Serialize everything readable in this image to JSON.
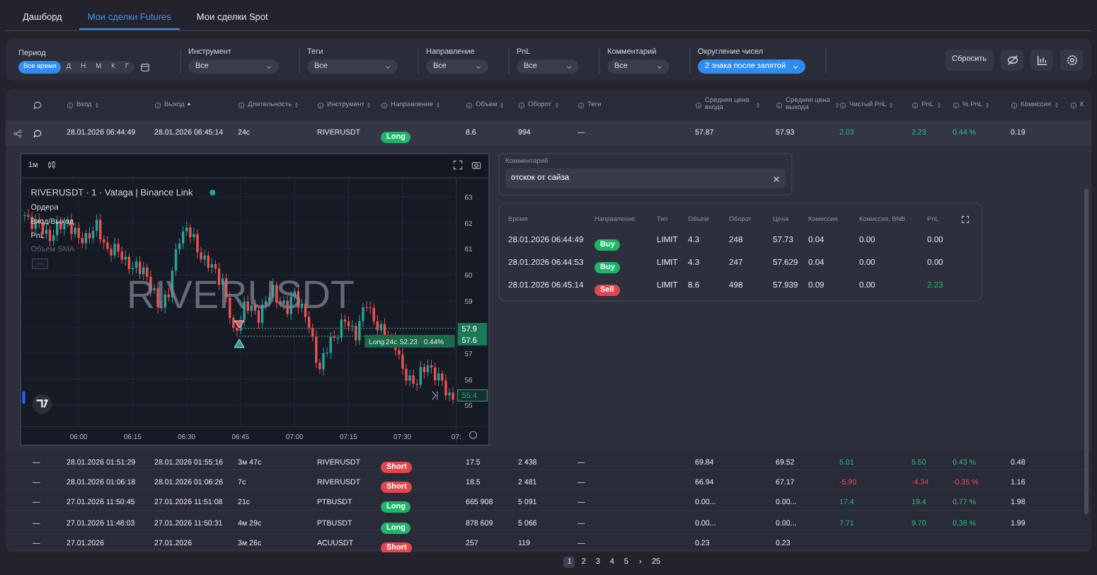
{
  "tabs": [
    {
      "label": "Дашборд",
      "selected": false
    },
    {
      "label": "Мои сделки Futures",
      "selected": true
    },
    {
      "label": "Мои сделки Spot",
      "selected": false
    }
  ],
  "filters": {
    "period": {
      "label": "Период",
      "options": [
        {
          "label": "Все время",
          "selected": true
        },
        {
          "label": "Д",
          "selected": false
        },
        {
          "label": "Н",
          "selected": false
        },
        {
          "label": "М",
          "selected": false
        },
        {
          "label": "К",
          "selected": false
        },
        {
          "label": "Г",
          "selected": false
        }
      ]
    },
    "dropdowns": [
      {
        "label": "Инструмент",
        "value": "Все",
        "active": false
      },
      {
        "label": "Теги",
        "value": "Все",
        "active": false
      },
      {
        "label": "Направление",
        "value": "Все",
        "active": false
      },
      {
        "label": "PnL",
        "value": "Все",
        "active": false
      },
      {
        "label": "Комментарий",
        "value": "Все",
        "active": false
      },
      {
        "label": "Округление чисел",
        "value": "2 знака после запятой",
        "active": true
      }
    ],
    "reset_button": "Сбросить"
  },
  "table": {
    "columns": [
      {
        "label": "Вход",
        "sortable": true,
        "sorted": false
      },
      {
        "label": "Выход",
        "sortable": true,
        "sorted": true
      },
      {
        "label": "Длительность",
        "sortable": true,
        "sorted": false
      },
      {
        "label": "Инструмент",
        "sortable": true,
        "sorted": false
      },
      {
        "label": "Направление",
        "sortable": true,
        "sorted": false
      },
      {
        "label": "Объем",
        "sortable": true,
        "sorted": false
      },
      {
        "label": "Оборот",
        "sortable": true,
        "sorted": false
      },
      {
        "label": "Теги",
        "sortable": false,
        "sorted": false
      },
      {
        "label": "Средняя цена входа",
        "sortable": true,
        "sorted": false
      },
      {
        "label": "Средняя цена выхода",
        "sortable": true,
        "sorted": false
      },
      {
        "label": "Чистый PnL",
        "sortable": true,
        "sorted": false
      },
      {
        "label": "PnL",
        "sortable": true,
        "sorted": false
      },
      {
        "label": "% PnL",
        "sortable": true,
        "sorted": false
      },
      {
        "label": "Комиссия",
        "sortable": true,
        "sorted": false
      },
      {
        "label": "К",
        "sortable": false,
        "sorted": false
      }
    ],
    "rows": [
      {
        "expanded": true,
        "has_comment": true,
        "entry": "28.01.2026 06:44:49",
        "exit": "28.01.2026 06:45:14",
        "duration": "24с",
        "instrument": "RIVERUSDT",
        "direction": {
          "label": "Long",
          "kind": "long"
        },
        "volume": "8.6",
        "turnover": "994",
        "tags": "—",
        "avg_entry": "57.87",
        "avg_exit": "57.93",
        "net_pnl": "2.03",
        "pnl": "2.23",
        "pnl_pct": "0.44 %",
        "loss": false,
        "fee": "0.19"
      },
      {
        "expanded": false,
        "has_comment": false,
        "mark": "—",
        "entry": "28.01.2026 01:51:29",
        "exit": "28.01.2026 01:55:16",
        "duration": "3м 47с",
        "instrument": "RIVERUSDT",
        "direction": {
          "label": "Short",
          "kind": "short"
        },
        "volume": "17.5",
        "turnover": "2 438",
        "tags": "—",
        "avg_entry": "69.84",
        "avg_exit": "69.52",
        "net_pnl": "5.01",
        "pnl": "5.50",
        "pnl_pct": "0.43 %",
        "loss": false,
        "fee": "0.48"
      },
      {
        "expanded": false,
        "has_comment": false,
        "mark": "—",
        "entry": "28.01.2026 01:06:18",
        "exit": "28.01.2026 01:06:26",
        "duration": "7с",
        "instrument": "RIVERUSDT",
        "direction": {
          "label": "Short",
          "kind": "short"
        },
        "volume": "18.5",
        "turnover": "2 481",
        "tags": "—",
        "avg_entry": "66.94",
        "avg_exit": "67.17",
        "net_pnl": "-5.90",
        "pnl": "-4.34",
        "pnl_pct": "-0.35 %",
        "loss": true,
        "fee": "1.16"
      },
      {
        "expanded": false,
        "has_comment": false,
        "mark": "—",
        "entry": "27.01.2026 11:50:45",
        "exit": "27.01.2026 11:51:08",
        "duration": "21с",
        "instrument": "PTBUSDT",
        "direction": {
          "label": "Long",
          "kind": "long"
        },
        "volume": "665 908",
        "turnover": "5 091",
        "tags": "—",
        "avg_entry": "0.00...",
        "avg_exit": "0.00...",
        "net_pnl": "17.4",
        "pnl": "19.4",
        "pnl_pct": "0.77 %",
        "loss": false,
        "fee": "1.98"
      },
      {
        "expanded": false,
        "has_comment": false,
        "mark": "—",
        "entry": "27.01.2026 11:48:03",
        "exit": "27.01.2026 11:50:31",
        "duration": "4м 29с",
        "instrument": "PTBUSDT",
        "direction": {
          "label": "Long",
          "kind": "long"
        },
        "volume": "878 609",
        "turnover": "5 066",
        "tags": "—",
        "avg_entry": "0.00...",
        "avg_exit": "0.00...",
        "net_pnl": "7.71",
        "pnl": "9.70",
        "pnl_pct": "0.38 %",
        "loss": false,
        "fee": "1.99"
      },
      {
        "expanded": false,
        "has_comment": false,
        "mark": "—",
        "entry": "27.01.2026",
        "exit": "27.01.2026",
        "duration": "3м 26с",
        "instrument": "ACUUSDT",
        "direction": {
          "label": "Short",
          "kind": "short"
        },
        "volume": "257",
        "turnover": "119",
        "tags": "—",
        "avg_entry": "0.23",
        "avg_exit": "0.23"
      }
    ]
  },
  "detail": {
    "chart": {
      "interval": "1м",
      "title": "RIVERUSDT · 1 · Vataga | Binance Link",
      "legend": [
        {
          "label": "Ордера",
          "hidden": false
        },
        {
          "label": "Вход/Выход",
          "hidden": false
        },
        {
          "label": "PnL",
          "hidden": false
        },
        {
          "label": "Объем SMA",
          "hidden": true
        }
      ],
      "watermark": "RIVERUSDT",
      "price_labels": [
        "63",
        "62",
        "61",
        "60",
        "59",
        "57",
        "56",
        "55"
      ],
      "time_labels": [
        "06:00",
        "06:15",
        "06:30",
        "06:45",
        "07:00",
        "07:15",
        "07:30",
        "07:"
      ],
      "exit_tag": "57.9",
      "entry_tag": "57.6",
      "last_tag": "55.4",
      "position_label": [
        "Long",
        "24с",
        "52.23",
        "0.44%"
      ]
    },
    "comment": {
      "label": "Комментарий",
      "value": "отскок от сайза"
    },
    "trades": {
      "columns": [
        "Время",
        "Направление",
        "Тип",
        "Объем",
        "Оборот",
        "Цена",
        "Комиссия",
        "Комиссия, BNB",
        "PnL"
      ],
      "rows": [
        {
          "time": "28.01.2026 06:44:49",
          "side": {
            "label": "Buy",
            "kind": "buy"
          },
          "type": "LIMIT",
          "volume": "4.3",
          "turnover": "248",
          "price": "57.73",
          "fee": "0.04",
          "fee_bnb": "0.00",
          "pnl": "0.00",
          "profit": false
        },
        {
          "time": "28.01.2026 06:44:53",
          "side": {
            "label": "Buy",
            "kind": "buy"
          },
          "type": "LIMIT",
          "volume": "4.3",
          "turnover": "247",
          "price": "57.629",
          "fee": "0.04",
          "fee_bnb": "0.00",
          "pnl": "0.00",
          "profit": false
        },
        {
          "time": "28.01.2026 06:45:14",
          "side": {
            "label": "Sell",
            "kind": "sell"
          },
          "type": "LIMIT",
          "volume": "8.6",
          "turnover": "498",
          "price": "57.939",
          "fee": "0.09",
          "fee_bnb": "0.00",
          "pnl": "2.23",
          "profit": true
        }
      ]
    }
  },
  "pagination": {
    "pages": [
      {
        "label": "1",
        "selected": true
      },
      {
        "label": "2",
        "selected": false
      },
      {
        "label": "3",
        "selected": false
      },
      {
        "label": "4",
        "selected": false
      },
      {
        "label": "5",
        "selected": false
      }
    ],
    "next": "›",
    "last": "25"
  }
}
